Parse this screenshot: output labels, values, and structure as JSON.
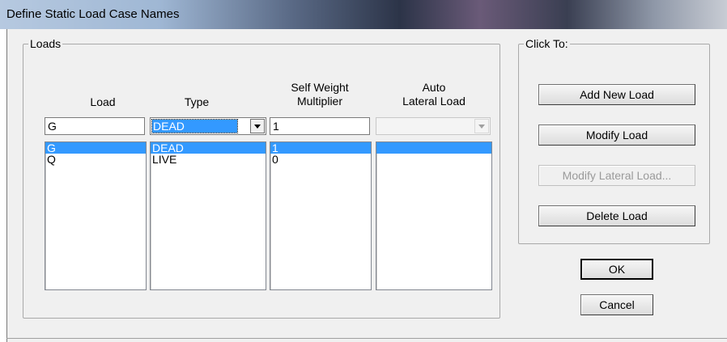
{
  "window": {
    "title": "Define Static Load Case Names"
  },
  "loads": {
    "group_label": "Loads",
    "headers": {
      "load": "Load",
      "type": "Type",
      "self_weight": "Self Weight\nMultiplier",
      "auto_lateral": "Auto\nLateral Load"
    },
    "edit": {
      "load_name": "G",
      "type": "DEAD",
      "self_weight": "1",
      "auto_lateral": ""
    },
    "rows": [
      {
        "load": "G",
        "type": "DEAD",
        "self_weight": "1",
        "auto_lateral": "",
        "selected": true
      },
      {
        "load": "Q",
        "type": "LIVE",
        "self_weight": "0",
        "auto_lateral": "",
        "selected": false
      }
    ]
  },
  "click_to": {
    "group_label": "Click To:",
    "add_new_load": "Add New Load",
    "modify_load": "Modify Load",
    "modify_lateral_load": "Modify Lateral Load...",
    "delete_load": "Delete Load"
  },
  "dialog": {
    "ok": "OK",
    "cancel": "Cancel"
  }
}
